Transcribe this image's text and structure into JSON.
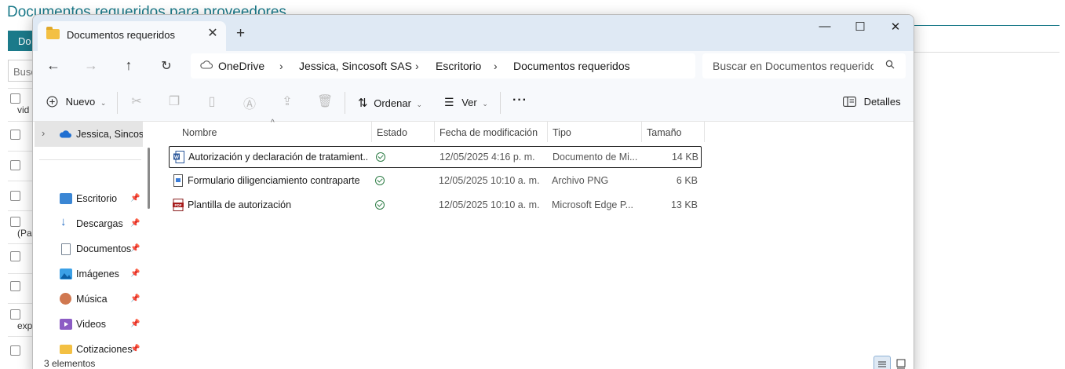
{
  "background_page": {
    "title": "Documentos requeridos para proveedores",
    "tab_label": "Do",
    "search_label": "Busc",
    "row_fragments": [
      "vid",
      "(Pa",
      "exp"
    ]
  },
  "window": {
    "tab_title": "Documentos requeridos",
    "controls": {
      "minimize": "—",
      "maximize": "☐",
      "close": "✕"
    },
    "address": {
      "segments": [
        "OneDrive",
        "Jessica, Sincosoft SAS",
        "Escritorio",
        "Documentos requeridos"
      ],
      "separator": "›"
    },
    "search_placeholder": "Buscar en Documentos requeridos"
  },
  "commands": {
    "new": "Nuevo",
    "sort": "Ordenar",
    "view": "Ver",
    "more": "···",
    "details": "Detalles"
  },
  "sidebar": {
    "selected": "Jessica, Sincosoft SAS",
    "items": [
      {
        "label": "Escritorio",
        "icon": "desktop-icon",
        "color": "#3a86d4"
      },
      {
        "label": "Descargas",
        "icon": "download-icon",
        "color": "#2b6fc4"
      },
      {
        "label": "Documentos",
        "icon": "documents-icon",
        "color": "#7a8797"
      },
      {
        "label": "Imágenes",
        "icon": "pictures-icon",
        "color": "#3ba0e6"
      },
      {
        "label": "Música",
        "icon": "music-icon",
        "color": "#d07850"
      },
      {
        "label": "Videos",
        "icon": "videos-icon",
        "color": "#8c5cc4"
      },
      {
        "label": "Cotizaciones",
        "icon": "folder-icon",
        "color": "#f3c043"
      }
    ]
  },
  "columns": [
    "Nombre",
    "Estado",
    "Fecha de modificación",
    "Tipo",
    "Tamaño"
  ],
  "files": [
    {
      "name": "Autorización y declaración de tratamient...",
      "date": "12/05/2025 4:16 p. m.",
      "type": "Documento de Mi...",
      "size": "14 KB",
      "icon": "word-icon"
    },
    {
      "name": "Formulario diligenciamiento contraparte",
      "date": "12/05/2025 10:10 a. m.",
      "type": "Archivo PNG",
      "size": "6 KB",
      "icon": "png-icon"
    },
    {
      "name": "Plantilla de autorización",
      "date": "12/05/2025 10:10 a. m.",
      "type": "Microsoft Edge P...",
      "size": "13 KB",
      "icon": "pdf-icon"
    }
  ],
  "status": "3 elementos"
}
